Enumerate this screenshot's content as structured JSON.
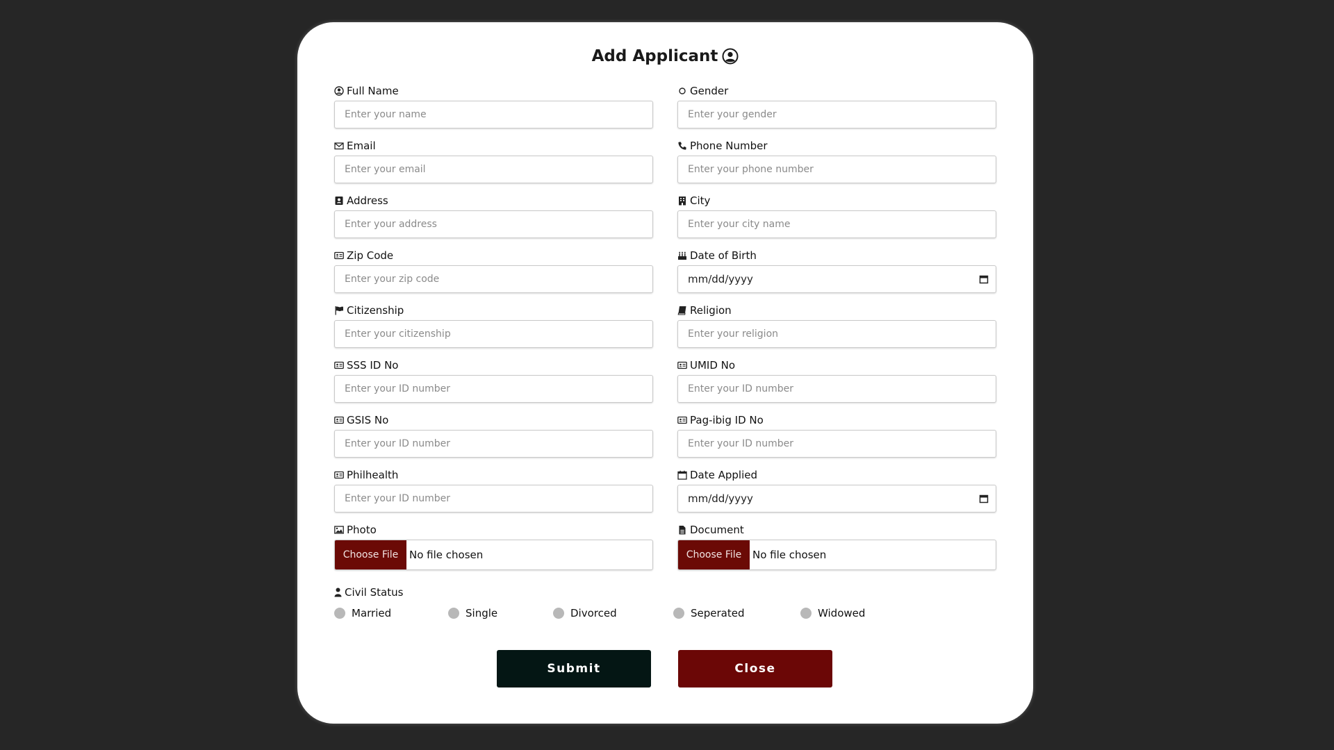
{
  "title": "Add Applicant",
  "fields": [
    {
      "label": "Full Name",
      "placeholder": "Enter your name",
      "icon": "user-circle-icon"
    },
    {
      "label": "Gender",
      "placeholder": "Enter your gender",
      "icon": "circle-icon"
    },
    {
      "label": "Email",
      "placeholder": "Enter your email",
      "icon": "envelope-icon"
    },
    {
      "label": "Phone Number",
      "placeholder": "Enter your phone number",
      "icon": "phone-icon"
    },
    {
      "label": "Address",
      "placeholder": "Enter your address",
      "icon": "address-book-icon"
    },
    {
      "label": "City",
      "placeholder": "Enter your city name",
      "icon": "building-icon"
    },
    {
      "label": "Zip Code",
      "placeholder": "Enter your zip code",
      "icon": "id-card-icon"
    },
    {
      "label": "Date of Birth",
      "value": "mm/dd/yyyy",
      "icon": "birthday-cake-icon"
    },
    {
      "label": "Citizenship",
      "placeholder": "Enter your citizenship",
      "icon": "flag-icon"
    },
    {
      "label": "Religion",
      "placeholder": "Enter your religion",
      "icon": "book-icon"
    },
    {
      "label": "SSS ID No",
      "placeholder": "Enter your ID number",
      "icon": "id-card-icon"
    },
    {
      "label": "UMID No",
      "placeholder": "Enter your ID number",
      "icon": "id-card-icon"
    },
    {
      "label": "GSIS No",
      "placeholder": "Enter your ID number",
      "icon": "id-card-icon"
    },
    {
      "label": "Pag-ibig ID No",
      "placeholder": "Enter your ID number",
      "icon": "id-card-icon"
    },
    {
      "label": "Philhealth",
      "placeholder": "Enter your ID number",
      "icon": "id-card-icon"
    },
    {
      "label": "Date Applied",
      "value": "mm/dd/yyyy",
      "icon": "calendar-icon"
    }
  ],
  "photo": {
    "label": "Photo",
    "button": "Choose File",
    "status": "No file chosen",
    "icon": "image-icon"
  },
  "document": {
    "label": "Document",
    "button": "Choose File",
    "status": "No file chosen",
    "icon": "file-icon"
  },
  "civil_status": {
    "label": "Civil Status",
    "icon": "user-icon",
    "options": [
      "Married",
      "Single",
      "Divorced",
      "Seperated",
      "Widowed"
    ]
  },
  "buttons": {
    "submit": "Submit",
    "close": "Close"
  },
  "colors": {
    "background": "#262626",
    "accent": "#6b0706",
    "submit": "#041614"
  }
}
